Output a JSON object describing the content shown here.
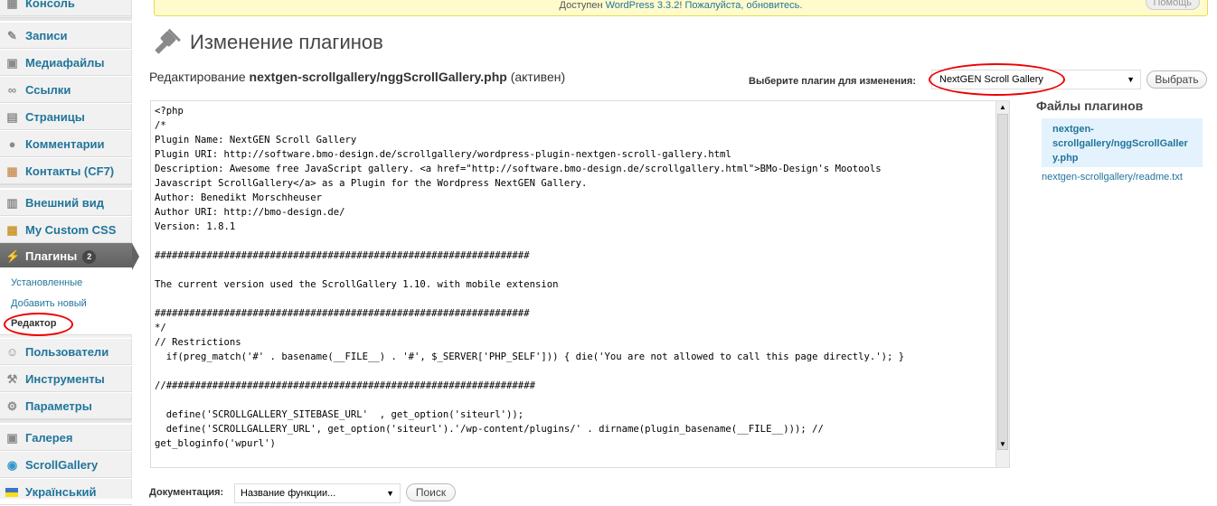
{
  "menu": {
    "items": [
      {
        "label": "Консоль",
        "icon": "dashboard-icon"
      },
      {
        "label": "Записи",
        "icon": "pin-icon"
      },
      {
        "label": "Медиафайлы",
        "icon": "media-icon"
      },
      {
        "label": "Ссылки",
        "icon": "link-icon"
      },
      {
        "label": "Страницы",
        "icon": "pages-icon"
      },
      {
        "label": "Комментарии",
        "icon": "comments-icon"
      },
      {
        "label": "Контакты (CF7)",
        "icon": "contacts-icon"
      },
      {
        "label": "Внешний вид",
        "icon": "appearance-icon"
      },
      {
        "label": "My Custom CSS",
        "icon": "css-icon"
      },
      {
        "label": "Плагины",
        "icon": "plugin-icon",
        "badge": "2"
      },
      {
        "label": "Пользователи",
        "icon": "users-icon"
      },
      {
        "label": "Инструменты",
        "icon": "tools-icon"
      },
      {
        "label": "Параметры",
        "icon": "settings-icon"
      },
      {
        "label": "Галерея",
        "icon": "gallery-icon"
      },
      {
        "label": "ScrollGallery",
        "icon": "scrollgallery-icon"
      },
      {
        "label": "Український",
        "icon": "flag-icon"
      }
    ],
    "submenu": [
      "Установленные",
      "Добавить новый",
      "Редактор"
    ]
  },
  "notice": {
    "prefix": "Доступен ",
    "link1": "WordPress 3.3.2",
    "sep": "! ",
    "link2": "Пожалуйста, обновитесь",
    "suffix": ".",
    "help": "Помощь"
  },
  "page": {
    "title": "Изменение плагинов",
    "edit_prefix": "Редактирование ",
    "edit_file": "nextgen-scrollgallery/nggScrollGallery.php",
    "edit_suffix": " (активен)",
    "picker_label": "Выберите плагин для изменения:",
    "picker_value": "NextGEN Scroll Gallery",
    "select_button": "Выбрать"
  },
  "editor": {
    "code": "<?php\n/*\nPlugin Name: NextGEN Scroll Gallery\nPlugin URI: http://software.bmo-design.de/scrollgallery/wordpress-plugin-nextgen-scroll-gallery.html\nDescription: Awesome free JavaScript gallery. <a href=\"http://software.bmo-design.de/scrollgallery.html\">BMo-Design's Mootools\nJavascript ScrollGallery</a> as a Plugin for the Wordpress NextGEN Gallery.\nAuthor: Benedikt Morschheuser\nAuthor URI: http://bmo-design.de/\nVersion: 1.8.1\n\n#################################################################\n\nThe current version used the ScrollGallery 1.10. with mobile extension\n\n#################################################################\n*/\n// Restrictions\n  if(preg_match('#' . basename(__FILE__) . '#', $_SERVER['PHP_SELF'])) { die('You are not allowed to call this page directly.'); }\n\n//################################################################\n\n  define('SCROLLGALLERY_SITEBASE_URL'  , get_option('siteurl'));\n  define('SCROLLGALLERY_URL', get_option('siteurl').'/wp-content/plugins/' . dirname(plugin_basename(__FILE__))); //\nget_bloginfo('wpurl')\n\n//################################################################"
  },
  "files": {
    "title": "Файлы плагинов",
    "items": [
      "nextgen-scrollgallery/nggScrollGallery.php",
      "nextgen-scrollgallery/readme.txt"
    ],
    "item1_lines": [
      "nextgen-",
      "scrollgallery/nggScrollGaller",
      "y.php"
    ]
  },
  "docs": {
    "label": "Документация:",
    "placeholder": "Название функции...",
    "button": "Поиск"
  },
  "colors": {
    "link": "#21759b",
    "highlight": "#e00000",
    "active_menu": "#6d6d6d"
  }
}
